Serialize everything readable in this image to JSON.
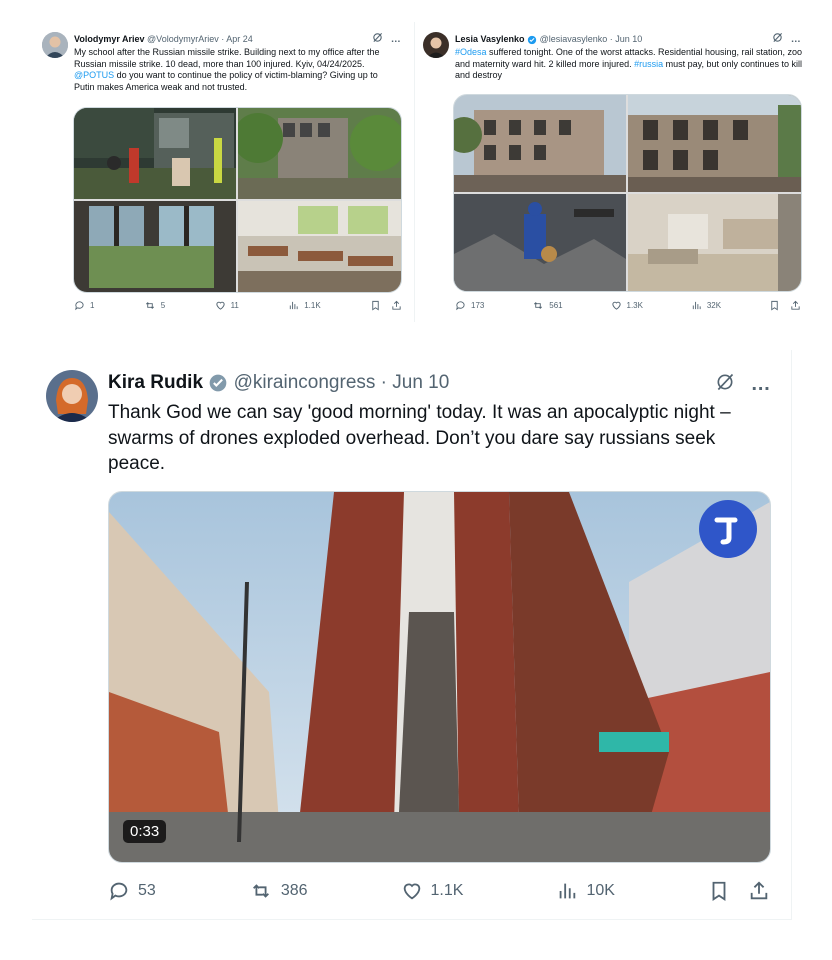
{
  "tweets": [
    {
      "name": "Volodymyr Ariev",
      "handle": "@VolodymyrAriev · Apr 24",
      "text_parts": {
        "a": "My school after the Russian missile strike. Building next to my office after the Russian missile strike. 10 dead, more than 100 injured. Kyiv, 04/24/2025. ",
        "mention": "@POTUS",
        "b": " do you want to continue the policy of victim-blaming? Giving up to Putin makes America weak and not trusted."
      },
      "stats": {
        "replies": "1",
        "reposts": "5",
        "likes": "11",
        "views": "1.1K"
      }
    },
    {
      "name": "Lesia Vasylenko",
      "handle": "@lesiavasylenko · Jun 10",
      "text_parts": {
        "tag1": "#Odesa",
        "a": " suffered tonight. One of the worst attacks. Residential housing, rail station, zoo and maternity ward hit. 2 killed more injured. ",
        "tag2": "#russia",
        "b": " must pay, but only continues to kill and destroy"
      },
      "stats": {
        "replies": "173",
        "reposts": "561",
        "likes": "1.3K",
        "views": "32K"
      }
    },
    {
      "name": "Kira Rudik",
      "handle": "@kiraincongress · Jun 10",
      "text": "Thank God we can say 'good morning' today. It was an apocalyptic night – swarms of drones exploded overhead. Don’t you dare say russians seek peace.",
      "video_duration": "0:33",
      "stats": {
        "replies": "53",
        "reposts": "386",
        "likes": "1.1K",
        "views": "10K"
      }
    }
  ],
  "icons": {
    "more": "…",
    "grok": "grok-icon",
    "reply": "reply-icon",
    "repost": "repost-icon",
    "like": "like-icon",
    "views": "views-icon",
    "bookmark": "bookmark-icon",
    "share": "share-icon",
    "verified": "verified-badge-icon"
  },
  "colors": {
    "link": "#1d9bf0",
    "muted": "#536471",
    "verified": "#829aab",
    "video_logo": "#2f56c9"
  }
}
